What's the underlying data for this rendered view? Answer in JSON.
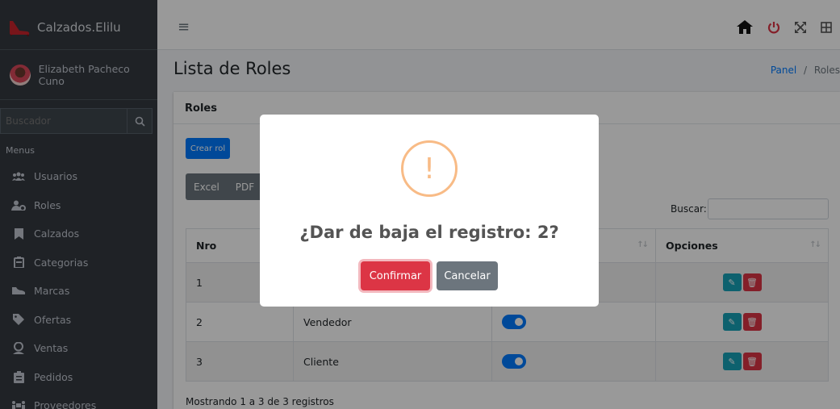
{
  "brand": {
    "name": "Calzados.Elilu"
  },
  "user": {
    "name": "Elizabeth Pacheco Cuno"
  },
  "sidebar": {
    "search_placeholder": "Buscador",
    "menu_header": "Menus",
    "items": [
      {
        "label": "Usuarios",
        "icon": "users-icon"
      },
      {
        "label": "Roles",
        "icon": "user-cog-icon"
      },
      {
        "label": "Calzados",
        "icon": "bookmark-icon"
      },
      {
        "label": "Categorias",
        "icon": "clipboard-icon"
      },
      {
        "label": "Marcas",
        "icon": "shoe-icon"
      },
      {
        "label": "Ofertas",
        "icon": "tag-icon"
      },
      {
        "label": "Ventas",
        "icon": "money-user-icon"
      },
      {
        "label": "Pedidos",
        "icon": "clipboard-list-icon"
      },
      {
        "label": "Proveedores",
        "icon": "people-carry-icon"
      }
    ]
  },
  "topbar": {
    "icons": [
      "home-icon",
      "power-icon",
      "expand-icon",
      "grid-icon"
    ]
  },
  "page": {
    "title": "Lista de Roles",
    "breadcrumb": {
      "link": "Panel",
      "separator": "/",
      "current": "Roles"
    }
  },
  "card": {
    "title": "Roles",
    "create_button": "Crear rol",
    "export": [
      "Excel",
      "PDF"
    ],
    "search_label": "Buscar:",
    "columns": {
      "nro": "Nro",
      "options": "Opciones"
    },
    "rows": [
      {
        "nro": "1",
        "name": ""
      },
      {
        "nro": "2",
        "name": "Vendedor"
      },
      {
        "nro": "3",
        "name": "Cliente"
      }
    ],
    "info": "Mostrando 1 a 3 de 3 registros"
  },
  "modal": {
    "icon": "!",
    "title": "¿Dar de baja el registro: 2?",
    "confirm": "Confirmar",
    "cancel": "Cancelar"
  },
  "colors": {
    "primary": "#007bff",
    "danger": "#dc3545",
    "info": "#17a2b8",
    "secondary": "#6c757d",
    "sidebar": "#343a40",
    "warning_icon": "#f8bb86"
  }
}
